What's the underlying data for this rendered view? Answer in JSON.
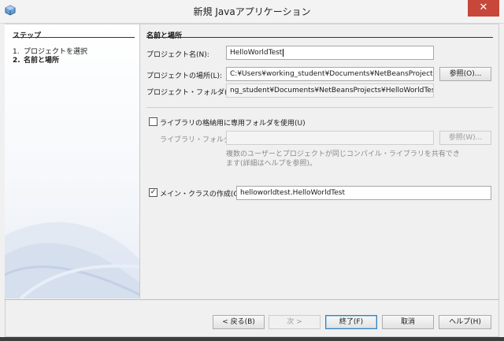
{
  "window": {
    "title": "新規 Javaアプリケーション",
    "close_glyph": "✕"
  },
  "sidebar": {
    "title": "ステップ",
    "steps": [
      {
        "num": "1.",
        "label": "プロジェクトを選択"
      },
      {
        "num": "2.",
        "label": "名前と場所"
      }
    ]
  },
  "content": {
    "section_title": "名前と場所",
    "project_name_label": "プロジェクト名(N):",
    "project_name_value": "HelloWorldTest",
    "project_location_label": "プロジェクトの場所(L):",
    "project_location_value": "C:¥Users¥working_student¥Documents¥NetBeansProjects",
    "browse_label": "参照(O)...",
    "project_folder_label": "プロジェクト・フォルダ(D):",
    "project_folder_value": "ng_student¥Documents¥NetBeansProjects¥HelloWorldTest",
    "dedicated_folder_checkbox_label": "ライブラリの格納用に専用フォルダを使用(U)",
    "library_folder_label": "ライブラリ・フォルダ(I):",
    "library_folder_value": "",
    "library_browse_label": "参照(W)...",
    "library_help_text_line1": "複数のユーザーとプロジェクトが同じコンパイル・ライブラリを共有でき",
    "library_help_text_line2": "ます(詳細はヘルプを参照)。",
    "main_class_checkbox_label": "メイン・クラスの作成(C)",
    "main_class_checked": true,
    "main_class_value": "helloworldtest.HelloWorldTest"
  },
  "footer": {
    "back_label": "< 戻る(B)",
    "next_label": "次 >",
    "finish_label": "終了(F)",
    "cancel_label": "取消",
    "help_label": "ヘルプ(H)"
  }
}
